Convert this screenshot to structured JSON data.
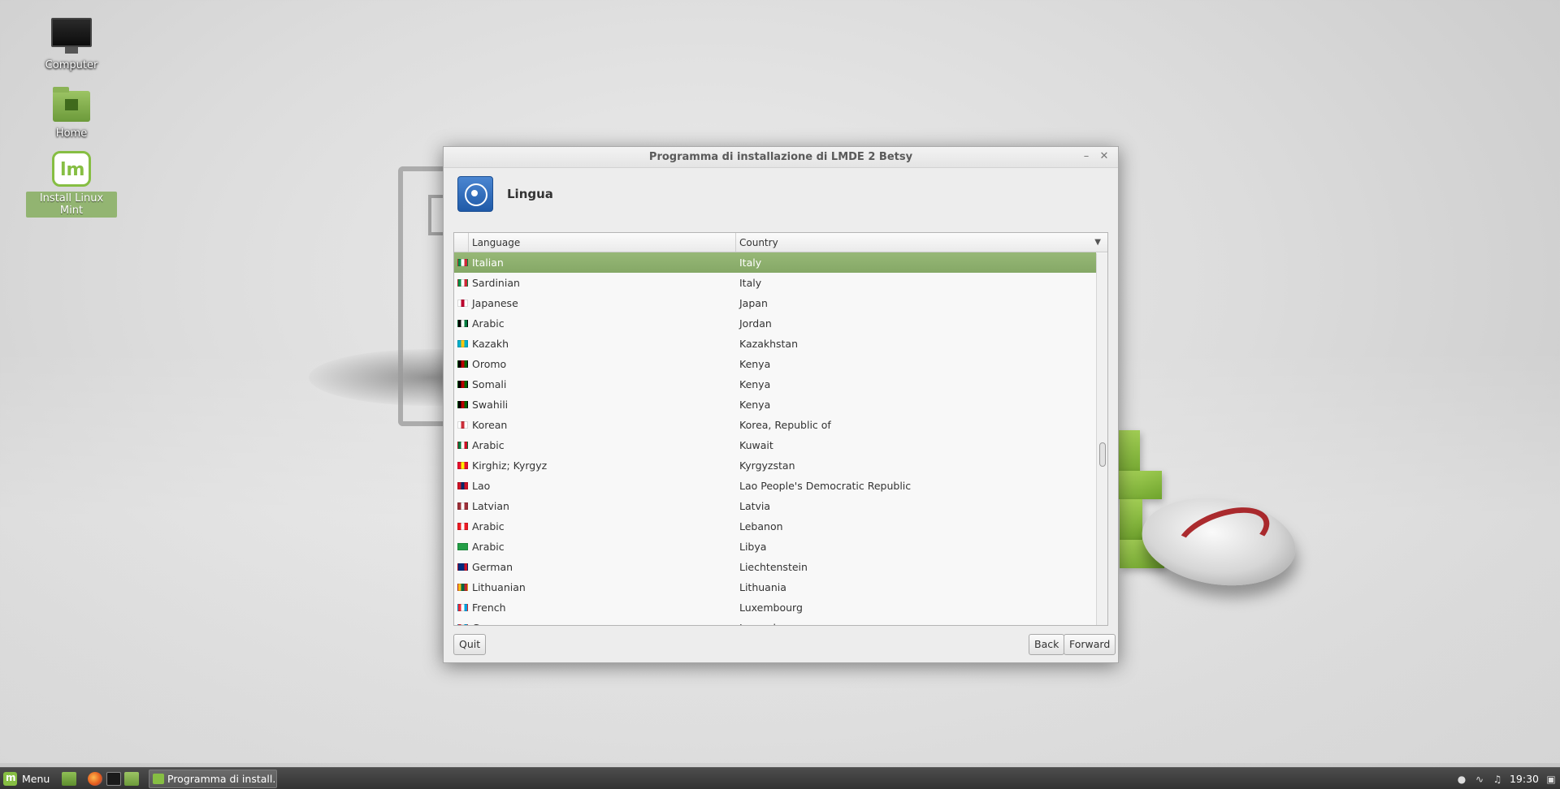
{
  "desktop": {
    "icons": [
      {
        "label": "Computer"
      },
      {
        "label": "Home"
      },
      {
        "label": "Install Linux Mint"
      }
    ]
  },
  "window": {
    "title": "Programma di installazione di LMDE 2 Betsy",
    "minimize_glyph": "–",
    "close_glyph": "✕",
    "page_title": "Lingua",
    "page_icon": "united-nations-icon",
    "table": {
      "columns": [
        "Language",
        "Country"
      ],
      "sort_glyph": "▼",
      "rows": [
        {
          "language": "Italian",
          "country": "Italy",
          "flag": [
            "#009246",
            "#ffffff",
            "#ce2b37"
          ],
          "selected": true
        },
        {
          "language": "Sardinian",
          "country": "Italy",
          "flag": [
            "#009246",
            "#ffffff",
            "#ce2b37"
          ]
        },
        {
          "language": "Japanese",
          "country": "Japan",
          "flag": [
            "#ffffff",
            "#bc002d",
            "#ffffff"
          ]
        },
        {
          "language": "Arabic",
          "country": "Jordan",
          "flag": [
            "#000000",
            "#ffffff",
            "#007a3d"
          ]
        },
        {
          "language": "Kazakh",
          "country": "Kazakhstan",
          "flag": [
            "#00afca",
            "#fec50c",
            "#00afca"
          ]
        },
        {
          "language": "Oromo",
          "country": "Kenya",
          "flag": [
            "#000000",
            "#bb0000",
            "#006600"
          ]
        },
        {
          "language": "Somali",
          "country": "Kenya",
          "flag": [
            "#000000",
            "#bb0000",
            "#006600"
          ]
        },
        {
          "language": "Swahili",
          "country": "Kenya",
          "flag": [
            "#000000",
            "#bb0000",
            "#006600"
          ]
        },
        {
          "language": "Korean",
          "country": "Korea, Republic of",
          "flag": [
            "#ffffff",
            "#cd2e3a",
            "#ffffff"
          ]
        },
        {
          "language": "Arabic",
          "country": "Kuwait",
          "flag": [
            "#007a3d",
            "#ffffff",
            "#ce1126"
          ]
        },
        {
          "language": "Kirghiz; Kyrgyz",
          "country": "Kyrgyzstan",
          "flag": [
            "#e8112d",
            "#ffef00",
            "#e8112d"
          ]
        },
        {
          "language": "Lao",
          "country": "Lao People's Democratic Republic",
          "flag": [
            "#ce1126",
            "#002868",
            "#ce1126"
          ]
        },
        {
          "language": "Latvian",
          "country": "Latvia",
          "flag": [
            "#9e3039",
            "#ffffff",
            "#9e3039"
          ]
        },
        {
          "language": "Arabic",
          "country": "Lebanon",
          "flag": [
            "#ed1c24",
            "#ffffff",
            "#ed1c24"
          ]
        },
        {
          "language": "Arabic",
          "country": "Libya",
          "flag": [
            "#239e46",
            "#239e46",
            "#239e46"
          ]
        },
        {
          "language": "German",
          "country": "Liechtenstein",
          "flag": [
            "#002b7f",
            "#002b7f",
            "#ce1126"
          ]
        },
        {
          "language": "Lithuanian",
          "country": "Lithuania",
          "flag": [
            "#fdb913",
            "#006a44",
            "#c1272d"
          ]
        },
        {
          "language": "French",
          "country": "Luxembourg",
          "flag": [
            "#ed2939",
            "#ffffff",
            "#00a1de"
          ]
        },
        {
          "language": "German",
          "country": "Luxembourg",
          "flag": [
            "#ed2939",
            "#ffffff",
            "#00a1de"
          ]
        }
      ]
    },
    "buttons": {
      "quit": "Quit",
      "back": "Back",
      "forward": "Forward"
    }
  },
  "taskbar": {
    "menu_label": "Menu",
    "task_label": "Programma di install...",
    "clock": "19:30",
    "tray_icons": [
      "user-icon",
      "network-icon",
      "volume-icon",
      "show-desktop-icon"
    ]
  },
  "colors": {
    "selection": "#8fb070",
    "mint_green": "#86be43",
    "taskbar": "#3f3f3f"
  }
}
